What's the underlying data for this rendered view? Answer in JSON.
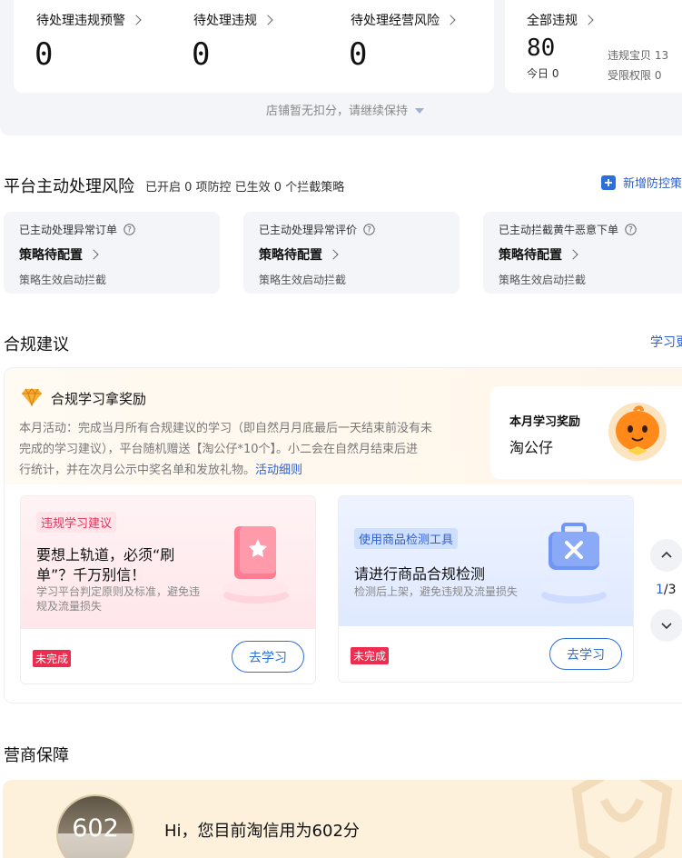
{
  "top": {
    "items": [
      {
        "label": "待处理违规预警",
        "value": "0"
      },
      {
        "label": "待处理违规",
        "value": "0"
      },
      {
        "label": "待处理经营风险",
        "value": "0"
      }
    ],
    "all_violations": {
      "label": "全部违规",
      "value": "80",
      "today_label": "今日 0",
      "items_label": "违规宝贝 13",
      "rights_label": "受限权限 0"
    },
    "footer": "店铺暂无扣分，请继续保持"
  },
  "risk": {
    "title": "平台主动处理风险",
    "summary": "已开启 0 项防控 已生效 0 个拦截策略",
    "add_button": "新增防控策",
    "cards": [
      {
        "title": "已主动处理异常订单",
        "action": "策略待配置",
        "desc": "策略生效启动拦截"
      },
      {
        "title": "已主动处理异常评价",
        "action": "策略待配置",
        "desc": "策略生效启动拦截"
      },
      {
        "title": "已主动拦截黄牛恶意下单",
        "action": "策略待配置",
        "desc": "策略生效启动拦截"
      }
    ]
  },
  "compliance": {
    "title": "合规建议",
    "more_link": "学习更",
    "reward_title": "合规学习拿奖励",
    "activity_line1": "本月活动：完成当月所有合规建议的学习（即自然月月底最后一天结束前没有未",
    "activity_line2": "完成的学习建议），平台随机赠送【淘公仔*10个】。小二会在自然月结束后进",
    "activity_line3": "行统计，并在次月公示中奖名单和发放礼物。",
    "activity_link": "活动细则",
    "monthly_reward_label": "本月学习奖励",
    "monthly_reward_value": "淘公仔",
    "cards": [
      {
        "tag": "违规学习建议",
        "title_line1": "要想上轨道，必须“刷",
        "title_line2": "单”？千万别信！",
        "desc_line1": "学习平台判定原则及标准，避免违",
        "desc_line2": "规及流量损失",
        "status": "未完成",
        "button": "去学习"
      },
      {
        "tag": "使用商品检测工具",
        "title_line1": "请进行商品合规检测",
        "desc_line1": "检测后上架，避免违规及流量损失",
        "status": "未完成",
        "button": "去学习"
      }
    ],
    "pager": {
      "current": "1",
      "total": "/3"
    }
  },
  "business": {
    "title": "营商保障",
    "score": "602",
    "greeting": "Hi，您目前淘信用为602分"
  }
}
